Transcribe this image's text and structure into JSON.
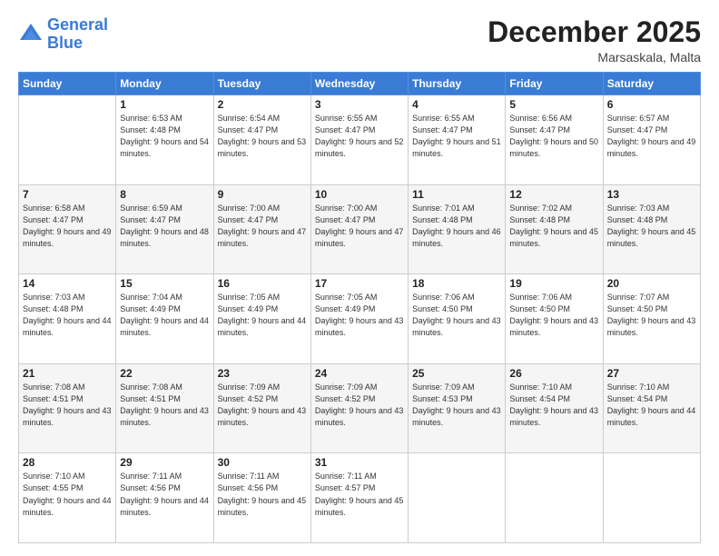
{
  "header": {
    "logo_line1": "General",
    "logo_line2": "Blue",
    "title": "December 2025",
    "subtitle": "Marsaskala, Malta"
  },
  "weekdays": [
    "Sunday",
    "Monday",
    "Tuesday",
    "Wednesday",
    "Thursday",
    "Friday",
    "Saturday"
  ],
  "weeks": [
    [
      {
        "day": "",
        "sunrise": "",
        "sunset": "",
        "daylight": ""
      },
      {
        "day": "1",
        "sunrise": "6:53 AM",
        "sunset": "4:48 PM",
        "daylight": "9 hours and 54 minutes."
      },
      {
        "day": "2",
        "sunrise": "6:54 AM",
        "sunset": "4:47 PM",
        "daylight": "9 hours and 53 minutes."
      },
      {
        "day": "3",
        "sunrise": "6:55 AM",
        "sunset": "4:47 PM",
        "daylight": "9 hours and 52 minutes."
      },
      {
        "day": "4",
        "sunrise": "6:55 AM",
        "sunset": "4:47 PM",
        "daylight": "9 hours and 51 minutes."
      },
      {
        "day": "5",
        "sunrise": "6:56 AM",
        "sunset": "4:47 PM",
        "daylight": "9 hours and 50 minutes."
      },
      {
        "day": "6",
        "sunrise": "6:57 AM",
        "sunset": "4:47 PM",
        "daylight": "9 hours and 49 minutes."
      }
    ],
    [
      {
        "day": "7",
        "sunrise": "6:58 AM",
        "sunset": "4:47 PM",
        "daylight": "9 hours and 49 minutes."
      },
      {
        "day": "8",
        "sunrise": "6:59 AM",
        "sunset": "4:47 PM",
        "daylight": "9 hours and 48 minutes."
      },
      {
        "day": "9",
        "sunrise": "7:00 AM",
        "sunset": "4:47 PM",
        "daylight": "9 hours and 47 minutes."
      },
      {
        "day": "10",
        "sunrise": "7:00 AM",
        "sunset": "4:47 PM",
        "daylight": "9 hours and 47 minutes."
      },
      {
        "day": "11",
        "sunrise": "7:01 AM",
        "sunset": "4:48 PM",
        "daylight": "9 hours and 46 minutes."
      },
      {
        "day": "12",
        "sunrise": "7:02 AM",
        "sunset": "4:48 PM",
        "daylight": "9 hours and 45 minutes."
      },
      {
        "day": "13",
        "sunrise": "7:03 AM",
        "sunset": "4:48 PM",
        "daylight": "9 hours and 45 minutes."
      }
    ],
    [
      {
        "day": "14",
        "sunrise": "7:03 AM",
        "sunset": "4:48 PM",
        "daylight": "9 hours and 44 minutes."
      },
      {
        "day": "15",
        "sunrise": "7:04 AM",
        "sunset": "4:49 PM",
        "daylight": "9 hours and 44 minutes."
      },
      {
        "day": "16",
        "sunrise": "7:05 AM",
        "sunset": "4:49 PM",
        "daylight": "9 hours and 44 minutes."
      },
      {
        "day": "17",
        "sunrise": "7:05 AM",
        "sunset": "4:49 PM",
        "daylight": "9 hours and 43 minutes."
      },
      {
        "day": "18",
        "sunrise": "7:06 AM",
        "sunset": "4:50 PM",
        "daylight": "9 hours and 43 minutes."
      },
      {
        "day": "19",
        "sunrise": "7:06 AM",
        "sunset": "4:50 PM",
        "daylight": "9 hours and 43 minutes."
      },
      {
        "day": "20",
        "sunrise": "7:07 AM",
        "sunset": "4:50 PM",
        "daylight": "9 hours and 43 minutes."
      }
    ],
    [
      {
        "day": "21",
        "sunrise": "7:08 AM",
        "sunset": "4:51 PM",
        "daylight": "9 hours and 43 minutes."
      },
      {
        "day": "22",
        "sunrise": "7:08 AM",
        "sunset": "4:51 PM",
        "daylight": "9 hours and 43 minutes."
      },
      {
        "day": "23",
        "sunrise": "7:09 AM",
        "sunset": "4:52 PM",
        "daylight": "9 hours and 43 minutes."
      },
      {
        "day": "24",
        "sunrise": "7:09 AM",
        "sunset": "4:52 PM",
        "daylight": "9 hours and 43 minutes."
      },
      {
        "day": "25",
        "sunrise": "7:09 AM",
        "sunset": "4:53 PM",
        "daylight": "9 hours and 43 minutes."
      },
      {
        "day": "26",
        "sunrise": "7:10 AM",
        "sunset": "4:54 PM",
        "daylight": "9 hours and 43 minutes."
      },
      {
        "day": "27",
        "sunrise": "7:10 AM",
        "sunset": "4:54 PM",
        "daylight": "9 hours and 44 minutes."
      }
    ],
    [
      {
        "day": "28",
        "sunrise": "7:10 AM",
        "sunset": "4:55 PM",
        "daylight": "9 hours and 44 minutes."
      },
      {
        "day": "29",
        "sunrise": "7:11 AM",
        "sunset": "4:56 PM",
        "daylight": "9 hours and 44 minutes."
      },
      {
        "day": "30",
        "sunrise": "7:11 AM",
        "sunset": "4:56 PM",
        "daylight": "9 hours and 45 minutes."
      },
      {
        "day": "31",
        "sunrise": "7:11 AM",
        "sunset": "4:57 PM",
        "daylight": "9 hours and 45 minutes."
      },
      {
        "day": "",
        "sunrise": "",
        "sunset": "",
        "daylight": ""
      },
      {
        "day": "",
        "sunrise": "",
        "sunset": "",
        "daylight": ""
      },
      {
        "day": "",
        "sunrise": "",
        "sunset": "",
        "daylight": ""
      }
    ]
  ]
}
